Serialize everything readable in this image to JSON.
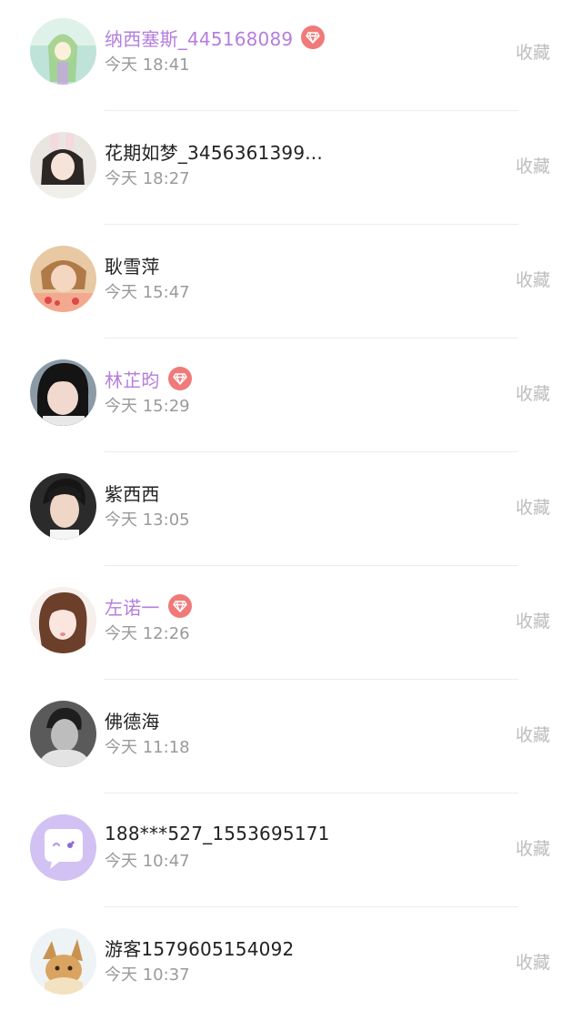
{
  "follow_list": {
    "items": [
      {
        "name": "纳西塞斯_445168089",
        "vip": true,
        "time": "今天 18:41",
        "action": "收藏",
        "avatar_icon": "avatar-anime-girl"
      },
      {
        "name": "花期如梦_3456361399...",
        "vip": false,
        "time": "今天 18:27",
        "action": "收藏",
        "avatar_icon": "avatar-bunny-ears-girl"
      },
      {
        "name": "耿雪萍",
        "vip": false,
        "time": "今天 15:47",
        "action": "收藏",
        "avatar_icon": "avatar-woman-photo"
      },
      {
        "name": "林芷昀",
        "vip": true,
        "time": "今天 15:29",
        "action": "收藏",
        "avatar_icon": "avatar-girl-bangs"
      },
      {
        "name": "紫西西",
        "vip": false,
        "time": "今天 13:05",
        "action": "收藏",
        "avatar_icon": "avatar-boy-photo"
      },
      {
        "name": "左诺一",
        "vip": true,
        "time": "今天 12:26",
        "action": "收藏",
        "avatar_icon": "avatar-girl-brown-hair"
      },
      {
        "name": "佛德海",
        "vip": false,
        "time": "今天 11:18",
        "action": "收藏",
        "avatar_icon": "avatar-man-bw"
      },
      {
        "name": "188***527_1553695171",
        "vip": false,
        "time": "今天 10:47",
        "action": "收藏",
        "avatar_icon": "avatar-default-chat-bubble"
      },
      {
        "name": "游客1579605154092",
        "vip": false,
        "time": "今天 10:37",
        "action": "收藏",
        "avatar_icon": "avatar-eevee-cartoon"
      }
    ]
  },
  "colors": {
    "vip_name": "#b57edc",
    "normal_name": "#222222",
    "time": "#9a9a9a",
    "action": "#bdbdbd",
    "vip_badge": "#f07a7a"
  }
}
